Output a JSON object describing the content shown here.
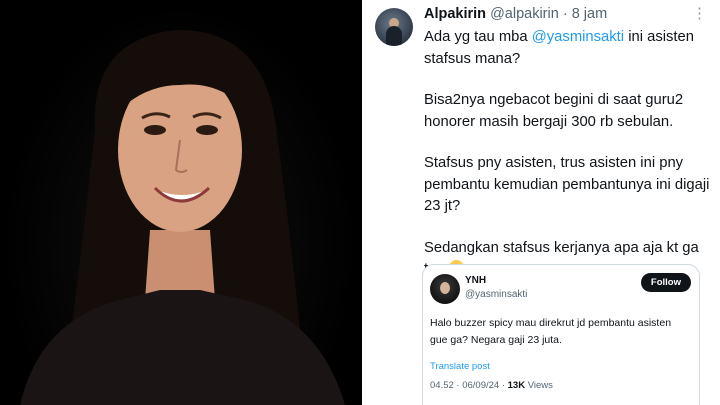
{
  "tweet": {
    "author_name": "Alpakirin",
    "author_handle": "@alpakirin",
    "separator": "·",
    "time": "8 jam",
    "line1_before": "Ada yg tau mba ",
    "mention": "@yasminsakti",
    "line1_after": " ini asisten stafsus mana?",
    "paragraph2": "Bisa2nya ngebacot begini di saat guru2 honorer masih bergaji 300 rb sebulan.",
    "paragraph3": "Stafsus pny asisten, trus asisten ini pny pembantu kemudian pembantunya ini digaji 23 jt?",
    "paragraph4": "Sedangkan stafsus kerjanya apa aja kt ga tau",
    "emoji": "grinning-face-emoji"
  },
  "quoted": {
    "name": "YNH",
    "handle": "@yasminsakti",
    "follow_label": "Follow",
    "text": "Halo buzzer spicy mau direkrut jd pembantu asisten gue ga? Negara gaji 23 juta.",
    "translate_label": "Translate post",
    "time": "04.52 · 06/09/24 · ",
    "views_count": "13K",
    "views_label": " Views"
  },
  "colors": {
    "link": "#1d9bf0",
    "text": "#0f1419",
    "muted": "#536471",
    "photo_bg": "#000000"
  }
}
